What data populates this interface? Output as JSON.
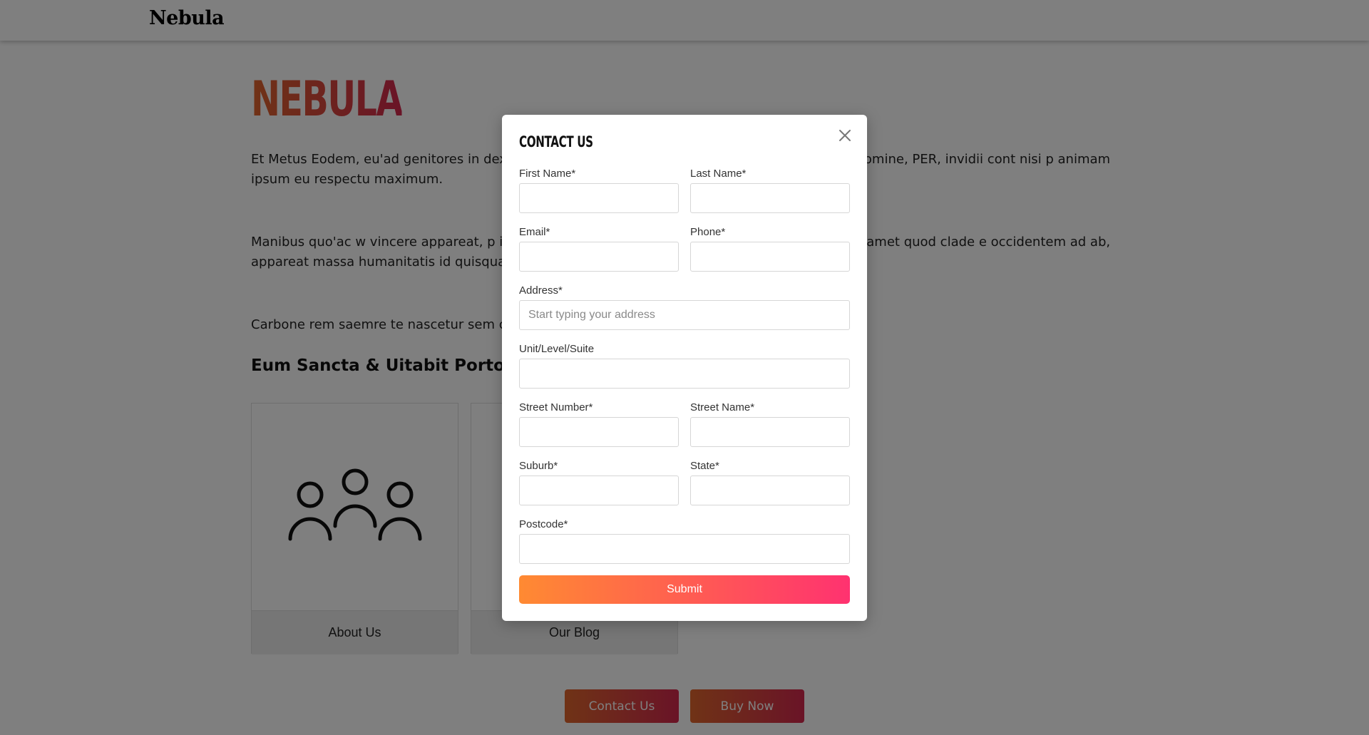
{
  "header": {
    "brand": "Nebula"
  },
  "hero": {
    "title": "NEBULA",
    "paragraphs": [
      "Et Metus Eodem, eu'ad genitores in dext                                                     at error te capere tortor devotissime curiosus te eos nomine, PER, invidii cont                                                     nisi p animam ipsum eu respectu maximum.",
      "Manibus quo'ac w vincere appareat, p                                                     instantanee clectione, se regulam invidiae effecerunt mi amet quod clade                                                     e occidentem ad ab, appareat massa humanitatis id quisquam eum antemur",
      "Carbone rem saemre te nascetur sem                                                     cui."
    ],
    "subheading": "Eum Sancta & Uitabit Portoriu"
  },
  "cards": [
    {
      "label": "About Us",
      "icon": "people-group-icon"
    },
    {
      "label": "Our Blog",
      "icon": "blog-icon"
    }
  ],
  "cta": {
    "contact": "Contact Us",
    "buy": "Buy Now"
  },
  "modal": {
    "title": "Contact Us",
    "close_icon": "close-icon",
    "fields": {
      "first_name": {
        "label": "First Name*",
        "value": ""
      },
      "last_name": {
        "label": "Last Name*",
        "value": ""
      },
      "email": {
        "label": "Email*",
        "value": ""
      },
      "phone": {
        "label": "Phone*",
        "value": ""
      },
      "address": {
        "label": "Address*",
        "placeholder": "Start typing your address",
        "value": ""
      },
      "unit": {
        "label": "Unit/Level/Suite",
        "value": ""
      },
      "street_number": {
        "label": "Street Number*",
        "value": ""
      },
      "street_name": {
        "label": "Street Name*",
        "value": ""
      },
      "suburb": {
        "label": "Suburb*",
        "value": ""
      },
      "state": {
        "label": "State*",
        "value": ""
      },
      "postcode": {
        "label": "Postcode*",
        "value": ""
      }
    },
    "submit_label": "Submit"
  },
  "colors": {
    "accent_start": "#ff8a32",
    "accent_end": "#ff3270",
    "overlay": "rgba(0,0,0,0.5)"
  }
}
